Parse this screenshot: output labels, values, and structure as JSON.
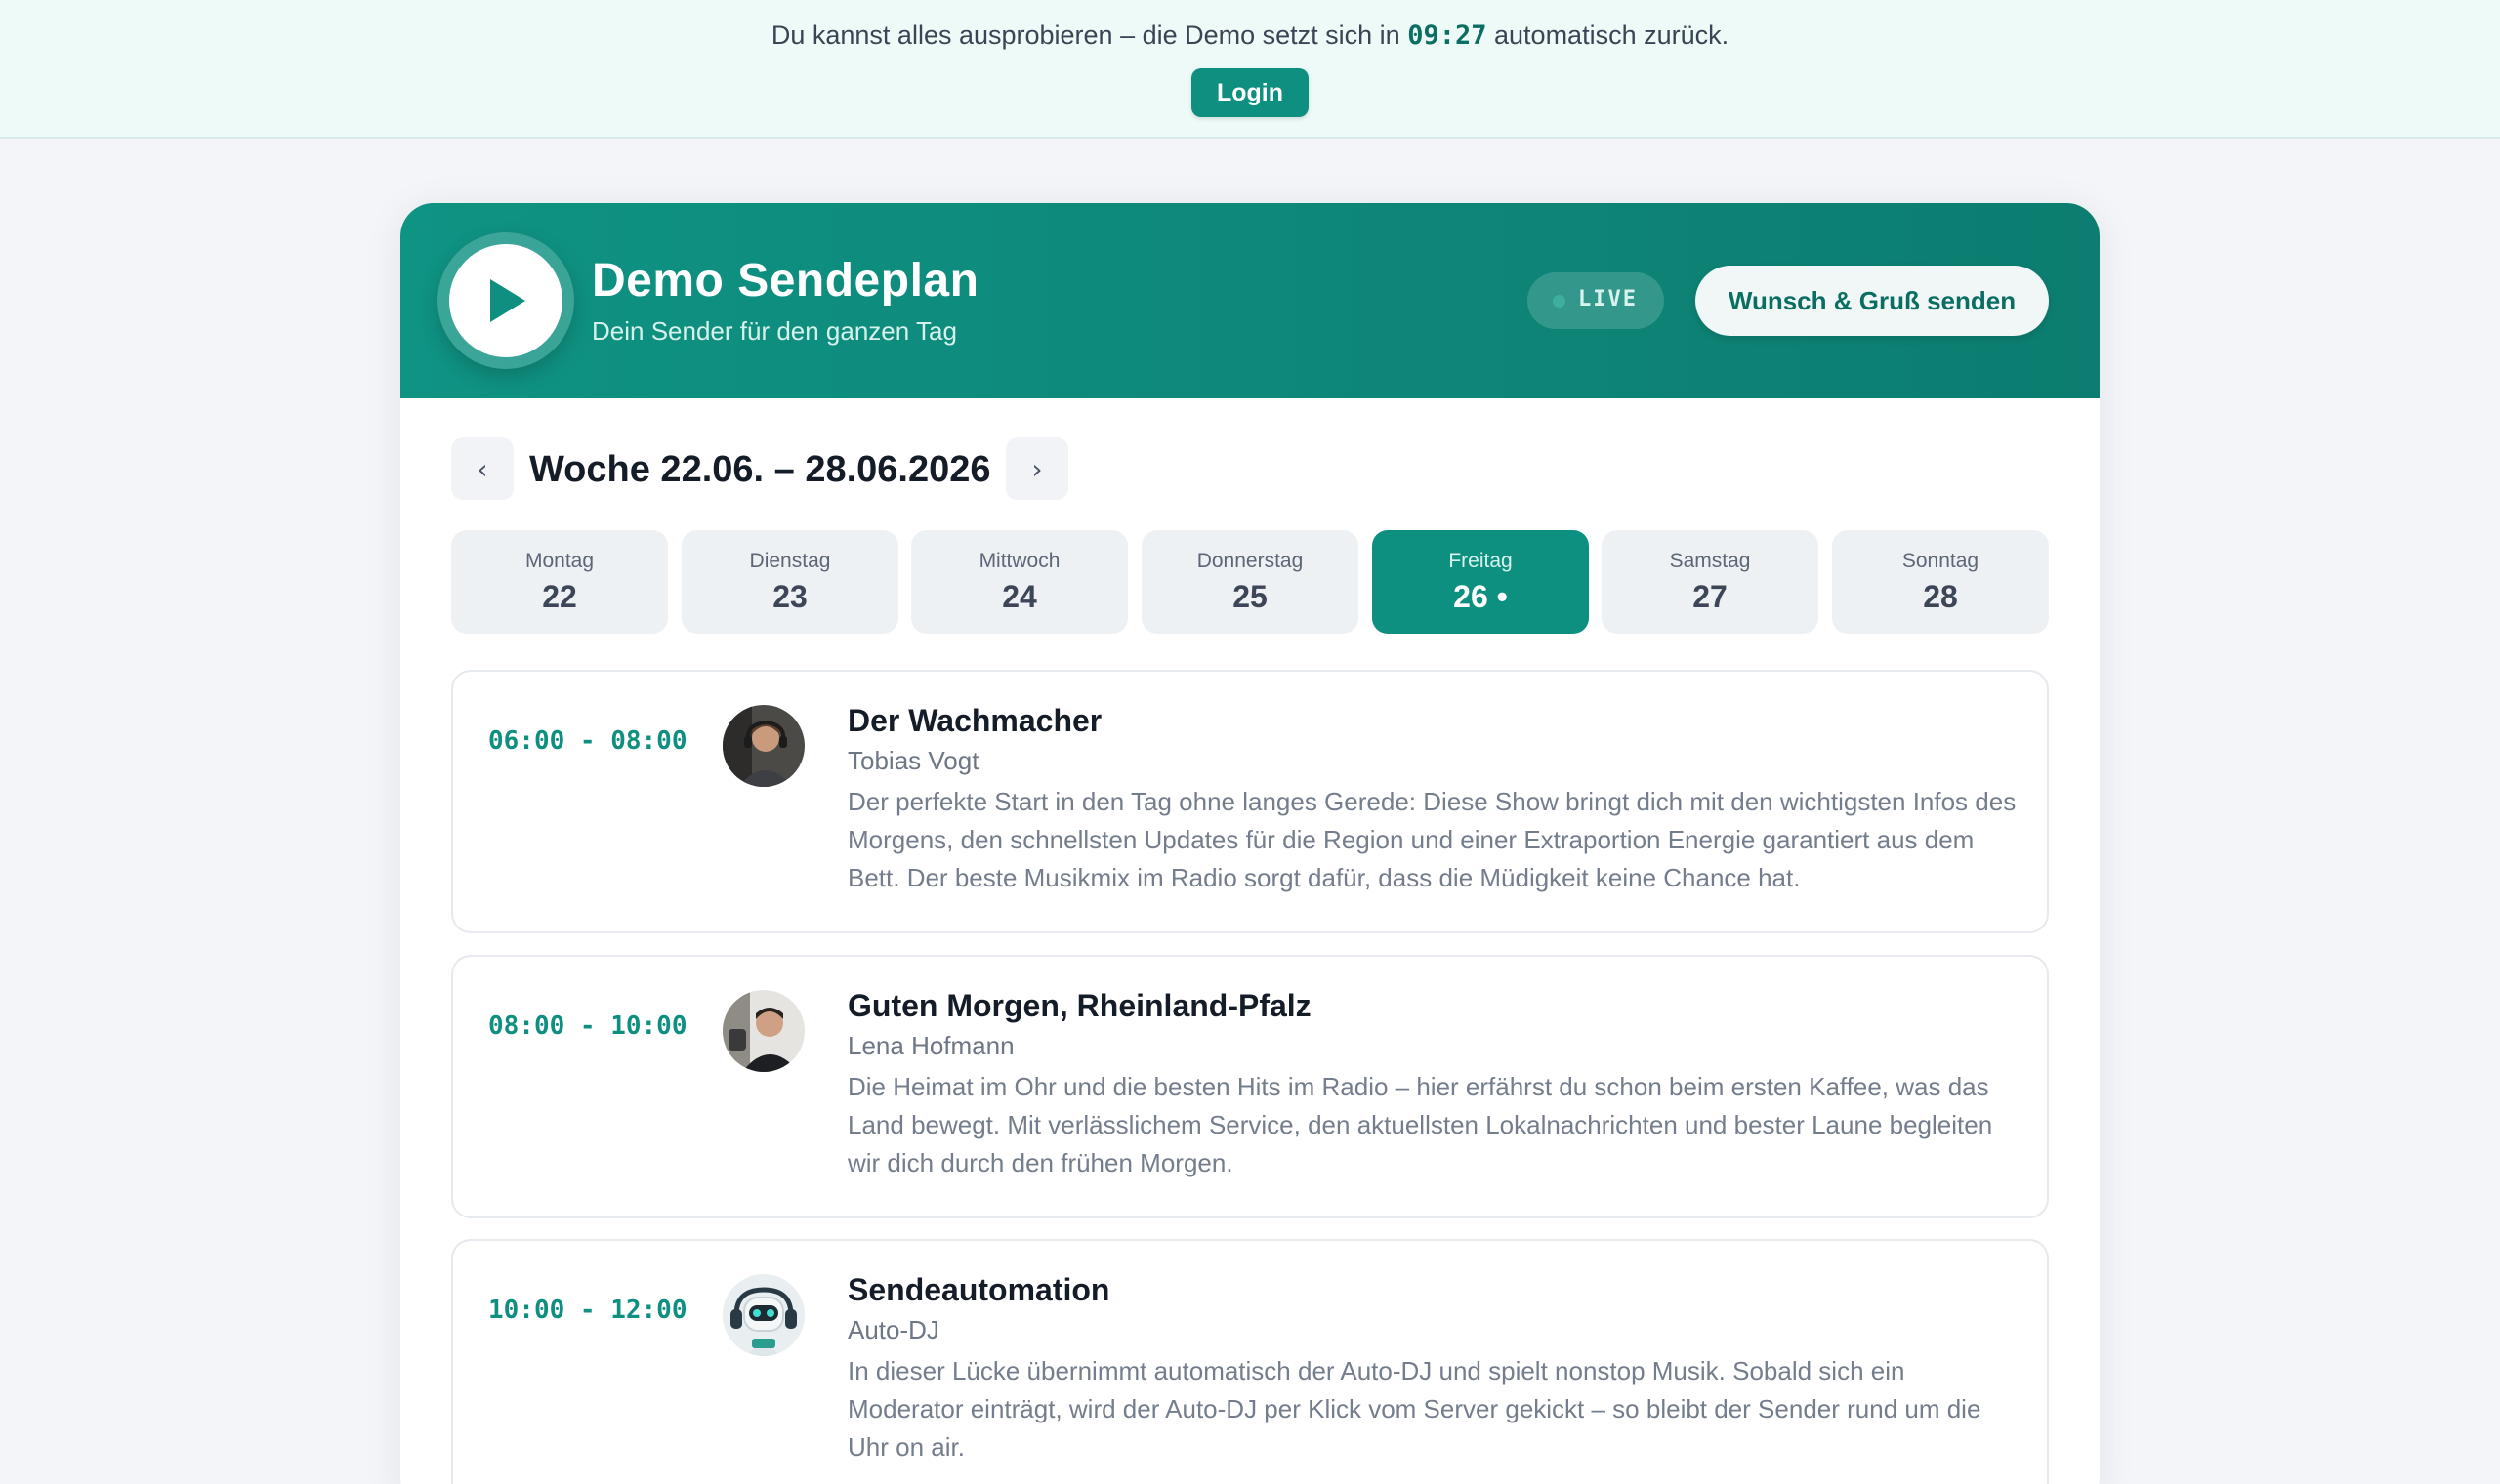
{
  "banner": {
    "text_before": "Du kannst alles ausprobieren – die Demo setzt sich in",
    "timer": "09:27",
    "text_after": "automatisch zurück.",
    "login_label": "Login"
  },
  "station": {
    "title": "Demo Sendeplan",
    "subtitle": "Dein Sender für den ganzen Tag",
    "live_label": "LIVE",
    "wish_label": "Wunsch & Gruß senden"
  },
  "week": {
    "title": "Woche 22.06. – 28.06.2026",
    "prev_symbol": "‹",
    "next_symbol": "›"
  },
  "days": [
    {
      "name": "Montag",
      "num": "22"
    },
    {
      "name": "Dienstag",
      "num": "23"
    },
    {
      "name": "Mittwoch",
      "num": "24"
    },
    {
      "name": "Donnerstag",
      "num": "25"
    },
    {
      "name": "Freitag",
      "num": "26 •"
    },
    {
      "name": "Samstag",
      "num": "27"
    },
    {
      "name": "Sonntag",
      "num": "28"
    }
  ],
  "active_day_index": 4,
  "shows": [
    {
      "time": "06:00 - 08:00",
      "title": "Der Wachmacher",
      "host": "Tobias Vogt",
      "description": "Der perfekte Start in den Tag ohne langes Gerede: Diese Show bringt dich mit den wichtigsten Infos des Morgens, den schnellsten Updates für die Region und einer Extraportion Energie garantiert aus dem Bett. Der beste Musikmix im Radio sorgt dafür, dass die Müdigkeit keine Chance hat.",
      "avatar_icon": "host-photo-avatar"
    },
    {
      "time": "08:00 - 10:00",
      "title": "Guten Morgen, Rheinland-Pfalz",
      "host": "Lena Hofmann",
      "description": "Die Heimat im Ohr und die besten Hits im Radio – hier erfährst du schon beim ersten Kaffee, was das Land bewegt. Mit verlässlichem Service, den aktuellsten Lokalnachrichten und bester Laune begleiten wir dich durch den frühen Morgen.",
      "avatar_icon": "host-photo-avatar"
    },
    {
      "time": "10:00 - 12:00",
      "title": "Sendeautomation",
      "host": "Auto-DJ",
      "description": "In dieser Lücke übernimmt automatisch der Auto-DJ und spielt nonstop Musik. Sobald sich ein Moderator einträgt, wird der Auto-DJ per Klick vom Server gekickt – so bleibt der Sender rund um die Uhr on air.",
      "avatar_icon": "robot-dj-avatar"
    }
  ],
  "colors": {
    "accent": "#0e8f80",
    "accent_dark": "#0b6e63",
    "banner_bg": "#eefaf8",
    "page_bg": "#f3f5f8"
  }
}
